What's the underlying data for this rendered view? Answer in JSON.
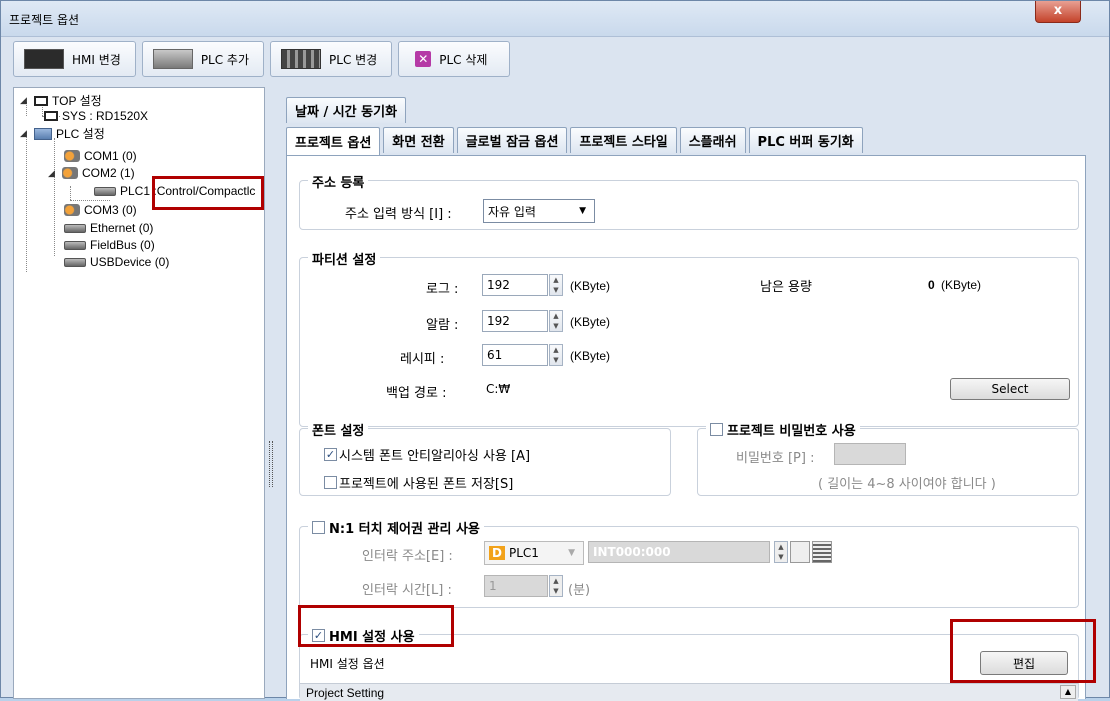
{
  "window": {
    "title": "프로젝트 옵션",
    "close_glyph": "x"
  },
  "toolbar": [
    {
      "label": "HMI 변경",
      "icon": "hmi-icon"
    },
    {
      "label": "PLC 추가",
      "icon": "plc-add-icon"
    },
    {
      "label": "PLC 변경",
      "icon": "plc-change-icon"
    },
    {
      "label": "PLC 삭제",
      "icon": "delete-icon",
      "glyph": "✕"
    }
  ],
  "tree": {
    "top": "TOP 설정",
    "sys": "SYS : RD1520X",
    "plc": "PLC 설정",
    "com1": "COM1 (0)",
    "com2": "COM2 (1)",
    "plc1_prefix": "PLC1 : ",
    "plc1_value": "Control/Compactlc",
    "com3": "COM3 (0)",
    "ethernet": "Ethernet (0)",
    "fieldbus": "FieldBus (0)",
    "usbdevice": "USBDevice (0)",
    "expanded_glyph": "◢",
    "collapsed_glyph": "▷"
  },
  "tabs": {
    "row1": [
      "날짜 / 시간 동기화"
    ],
    "row2": [
      "프로젝트 옵션",
      "화면 전환",
      "글로벌 잠금 옵션",
      "프로젝트 스타일",
      "스플래쉬",
      "PLC 버퍼 동기화"
    ],
    "active": "프로젝트 옵션"
  },
  "address": {
    "legend": "주소 등록",
    "label": "주소 입력 방식 [I] :",
    "value": "자유 입력"
  },
  "partition": {
    "legend": "파티션 설정",
    "log_label": "로그 :",
    "log_value": "192",
    "alarm_label": "알람 :",
    "alarm_value": "192",
    "recipe_label": "레시피 :",
    "recipe_value": "61",
    "unit": "(KByte)",
    "remaining_label": "남은 용량",
    "remaining_value": "0",
    "backup_label": "백업 경로 :",
    "backup_value": "C:₩",
    "select_button": "Select"
  },
  "font": {
    "legend": "폰트 설정",
    "antialias": "시스템 폰트 안티알리아싱 사용 [A]",
    "antialias_checked": true,
    "save_fonts": "프로젝트에 사용된 폰트 저장[S]",
    "save_fonts_checked": false
  },
  "password": {
    "legend": "프로젝트 비밀번호 사용",
    "label": "비밀번호 [P] :",
    "hint": "( 길이는 4~8 사이여야 합니다 )"
  },
  "touch": {
    "legend": "N:1 터치 제어권 관리 사용",
    "interlock_addr_label": "인터락 주소[E] :",
    "device": "PLC1",
    "device_badge": "D",
    "address": "INT000:000",
    "interlock_time_label": "인터락 시간[L] :",
    "time_value": "1",
    "time_unit": "(분)"
  },
  "hmi": {
    "legend": "HMI 설정 사용",
    "checked": true,
    "options_label": "HMI 설정 옵션",
    "edit_button": "편집",
    "project_setting": "Project Setting"
  },
  "check_glyph": "✓",
  "spin_up": "▲",
  "spin_down": "▼",
  "dropdown_glyph": "▼",
  "colors": {
    "highlight": "#b00000",
    "accent": "#2a4d7e"
  }
}
